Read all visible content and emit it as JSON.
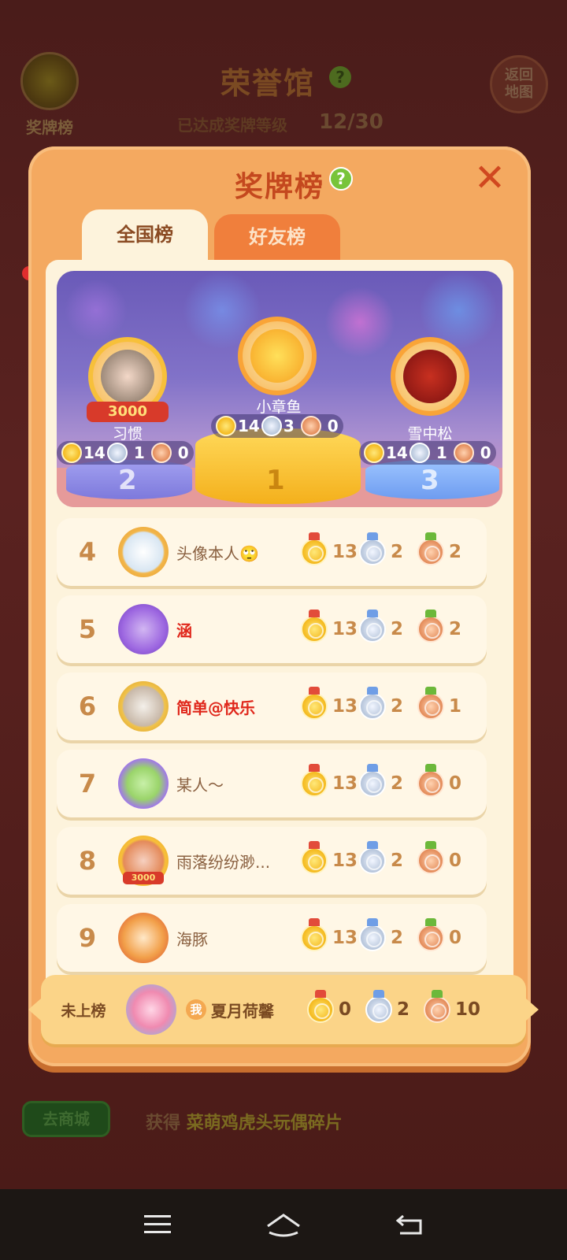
{
  "background": {
    "hall_title": "荣誉馆",
    "medal_button_label": "奖牌榜",
    "progress_label": "已达成奖牌等级",
    "progress_value": "12/30",
    "back_button_label": "返回\n地图",
    "shop_button_label": "去商城",
    "reward_prefix": "获得",
    "reward_item": "菜萌鸡虎头玩偶碎片"
  },
  "modal": {
    "title": "奖牌榜",
    "help_icon": "?",
    "close_icon": "✕",
    "tabs": [
      {
        "label": "全国榜",
        "active": true
      },
      {
        "label": "好友榜",
        "active": false
      }
    ]
  },
  "podium": {
    "first": {
      "rank": "1",
      "name": "小章鱼",
      "gold": "14",
      "silver": "3",
      "bronze": "0"
    },
    "second": {
      "rank": "2",
      "name": "习惯",
      "badge": "3000",
      "gold": "14",
      "silver": "1",
      "bronze": "0"
    },
    "third": {
      "rank": "3",
      "name": "雪中松",
      "gold": "14",
      "silver": "1",
      "bronze": "0"
    }
  },
  "rows": [
    {
      "rank": "4",
      "name": "头像本人🙄",
      "gold": "13",
      "silver": "2",
      "bronze": "2"
    },
    {
      "rank": "5",
      "name": "涵",
      "gold": "13",
      "silver": "2",
      "bronze": "2"
    },
    {
      "rank": "6",
      "name": "简单@快乐",
      "gold": "13",
      "silver": "2",
      "bronze": "1"
    },
    {
      "rank": "7",
      "name": "某人～",
      "gold": "13",
      "silver": "2",
      "bronze": "0"
    },
    {
      "rank": "8",
      "name": "雨落纷纷渺...",
      "badge": "3000",
      "gold": "13",
      "silver": "2",
      "bronze": "0"
    },
    {
      "rank": "9",
      "name": "海豚",
      "gold": "13",
      "silver": "2",
      "bronze": "0"
    }
  ],
  "self": {
    "rank_label": "未上榜",
    "me_badge": "我",
    "name": "夏月荷馨",
    "gold": "0",
    "silver": "2",
    "bronze": "10"
  },
  "colors": {
    "modal_bg": "#f4a960",
    "title_red": "#c4481e",
    "gold_medal": "#f4b81c",
    "silver_medal": "#b5c4da",
    "bronze_medal": "#e38a58"
  }
}
